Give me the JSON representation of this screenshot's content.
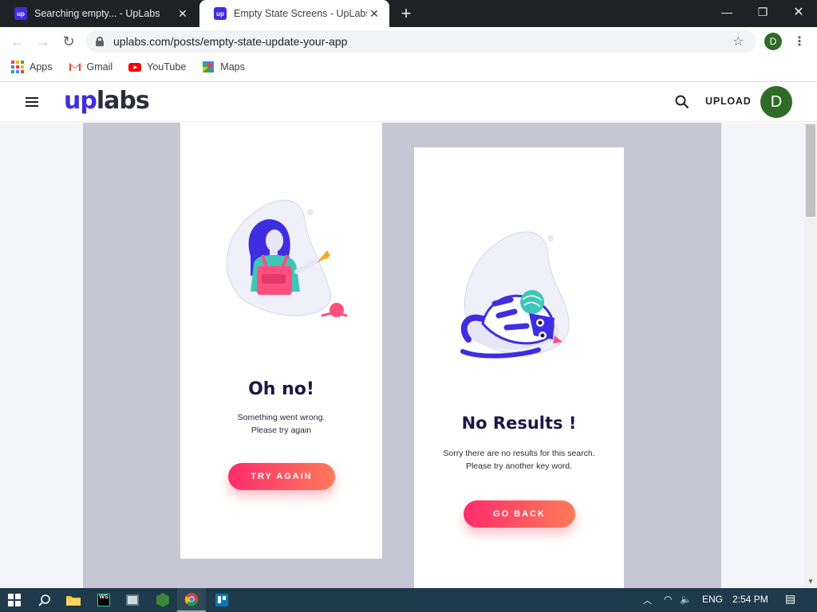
{
  "browser": {
    "tabs": [
      {
        "title": "Searching empty... - UpLabs",
        "favicon": "up"
      },
      {
        "title": "Empty State Screens - UpLabs",
        "favicon": "up"
      }
    ],
    "url": "uplabs.com/posts/empty-state-update-your-app",
    "profile_initial": "D",
    "bookmarks": [
      {
        "label": "Apps",
        "icon": "apps-grid-icon"
      },
      {
        "label": "Gmail",
        "icon": "gmail-icon"
      },
      {
        "label": "YouTube",
        "icon": "youtube-icon"
      },
      {
        "label": "Maps",
        "icon": "maps-icon"
      }
    ]
  },
  "site": {
    "logo_up": "up",
    "logo_labs": "labs",
    "upload_label": "UPLOAD",
    "avatar_initial": "D",
    "brand_color": "#3f2ee0"
  },
  "cards": [
    {
      "title": "Oh no!",
      "message_line1": "Something went wrong.",
      "message_line2": "Please try again",
      "button": "TRY AGAIN"
    },
    {
      "title": "No Results !",
      "message_line1": "Sorry there are no results for this search.",
      "message_line2": "Please try another key word.",
      "button": "GO BACK"
    }
  ],
  "taskbar": {
    "language": "ENG",
    "time": "2:54 PM",
    "apps": [
      "start-icon",
      "search-icon",
      "file-explorer-icon",
      "webstorm-icon",
      "app-icon",
      "node-icon",
      "chrome-icon",
      "trello-icon"
    ]
  }
}
